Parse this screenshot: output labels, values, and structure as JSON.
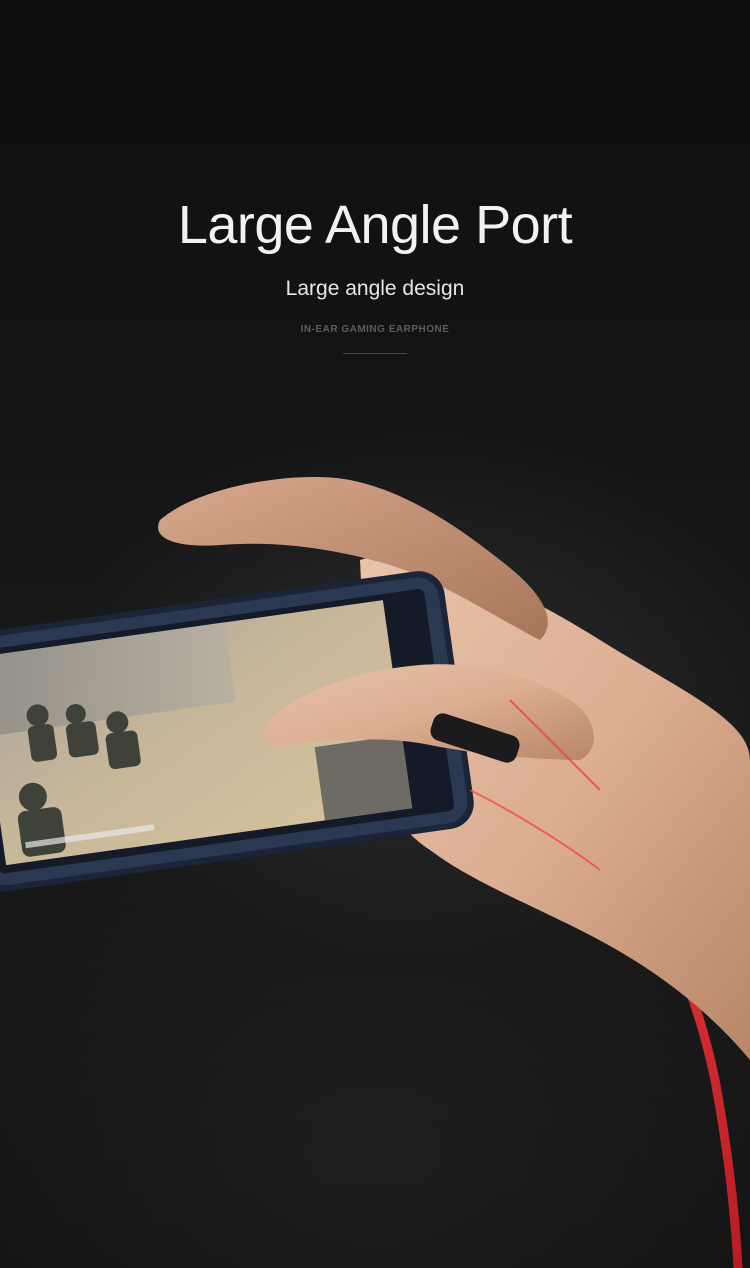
{
  "headline": {
    "title": "Large Angle Port",
    "subtitle": "Large angle design",
    "tagline": "IN-EAR GAMING EARPHONE"
  },
  "colors": {
    "background": "#121213",
    "cable": "#d8262c",
    "phone_frame": "#1f2a44"
  }
}
